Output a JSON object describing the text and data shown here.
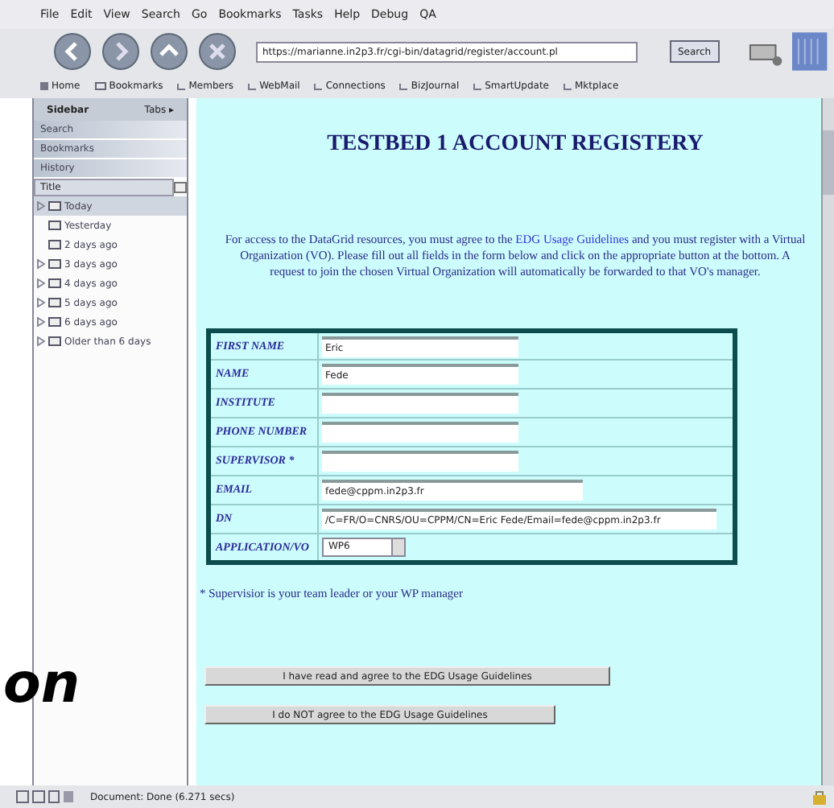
{
  "menu": [
    "File",
    "Edit",
    "View",
    "Search",
    "Go",
    "Bookmarks",
    "Tasks",
    "Help",
    "Debug",
    "QA"
  ],
  "url": "https://marianne.in2p3.fr/cgi-bin/datagrid/register/account.pl",
  "search_button": "Search",
  "personal_bar": [
    {
      "label": "Home",
      "kind": "home"
    },
    {
      "label": "Bookmarks",
      "kind": "folder"
    },
    {
      "label": "Members",
      "kind": "link"
    },
    {
      "label": "WebMail",
      "kind": "link"
    },
    {
      "label": "Connections",
      "kind": "link"
    },
    {
      "label": "BizJournal",
      "kind": "link"
    },
    {
      "label": "SmartUpdate",
      "kind": "link"
    },
    {
      "label": "Mktplace",
      "kind": "link"
    }
  ],
  "sidebar": {
    "title": "Sidebar",
    "tabs_label": "Tabs ▸",
    "panels": [
      {
        "label": "Search"
      },
      {
        "label": "Bookmarks"
      },
      {
        "label": "History"
      }
    ],
    "column": "Title",
    "history": [
      {
        "label": "Today",
        "expandable": true,
        "selected": true
      },
      {
        "label": "Yesterday",
        "expandable": false,
        "selected": false
      },
      {
        "label": "2 days ago",
        "expandable": false,
        "selected": false
      },
      {
        "label": "3 days ago",
        "expandable": true,
        "selected": false
      },
      {
        "label": "4 days ago",
        "expandable": true,
        "selected": false
      },
      {
        "label": "5 days ago",
        "expandable": true,
        "selected": false
      },
      {
        "label": "6 days ago",
        "expandable": true,
        "selected": false
      },
      {
        "label": "Older than 6 days",
        "expandable": true,
        "selected": false
      }
    ]
  },
  "page": {
    "title": "TESTBED 1 ACCOUNT REGISTERY",
    "intro_before": "For access to the DataGrid resources, you must agree to the ",
    "intro_link": "EDG Usage Guidelines",
    "intro_after": " and you must register with a Virtual Organization (VO). Please fill out all fields in the form below and click on the appropriate button at the bottom. A request to join the chosen Virtual Organization will automatically be forwarded to that VO's manager.",
    "form": [
      {
        "label": "FIRST NAME",
        "value": "Eric",
        "kind": "short"
      },
      {
        "label": "NAME",
        "value": "Fede",
        "kind": "short"
      },
      {
        "label": "INSTITUTE",
        "kind": "short"
      },
      {
        "label": "PHONE NUMBER",
        "kind": "short"
      },
      {
        "label": "SUPERVISOR *",
        "kind": "short"
      },
      {
        "label": "EMAIL",
        "value": "fede@cppm.in2p3.fr",
        "kind": "medium"
      },
      {
        "label": "DN",
        "value": "/C=FR/O=CNRS/OU=CPPM/CN=Eric Fede/Email=fede@cppm.in2p3.fr",
        "kind": "long"
      },
      {
        "label": "APPLICATION/VO",
        "value": "WP6",
        "kind": "select"
      }
    ],
    "note": "* Supervisior is your team leader or your WP manager",
    "buttons": [
      "I have read and agree to the EDG Usage Guidelines",
      "I do NOT agree to the EDG Usage Guidelines"
    ]
  },
  "status": "Document: Done (6.271 secs)",
  "overlay_text": "on"
}
